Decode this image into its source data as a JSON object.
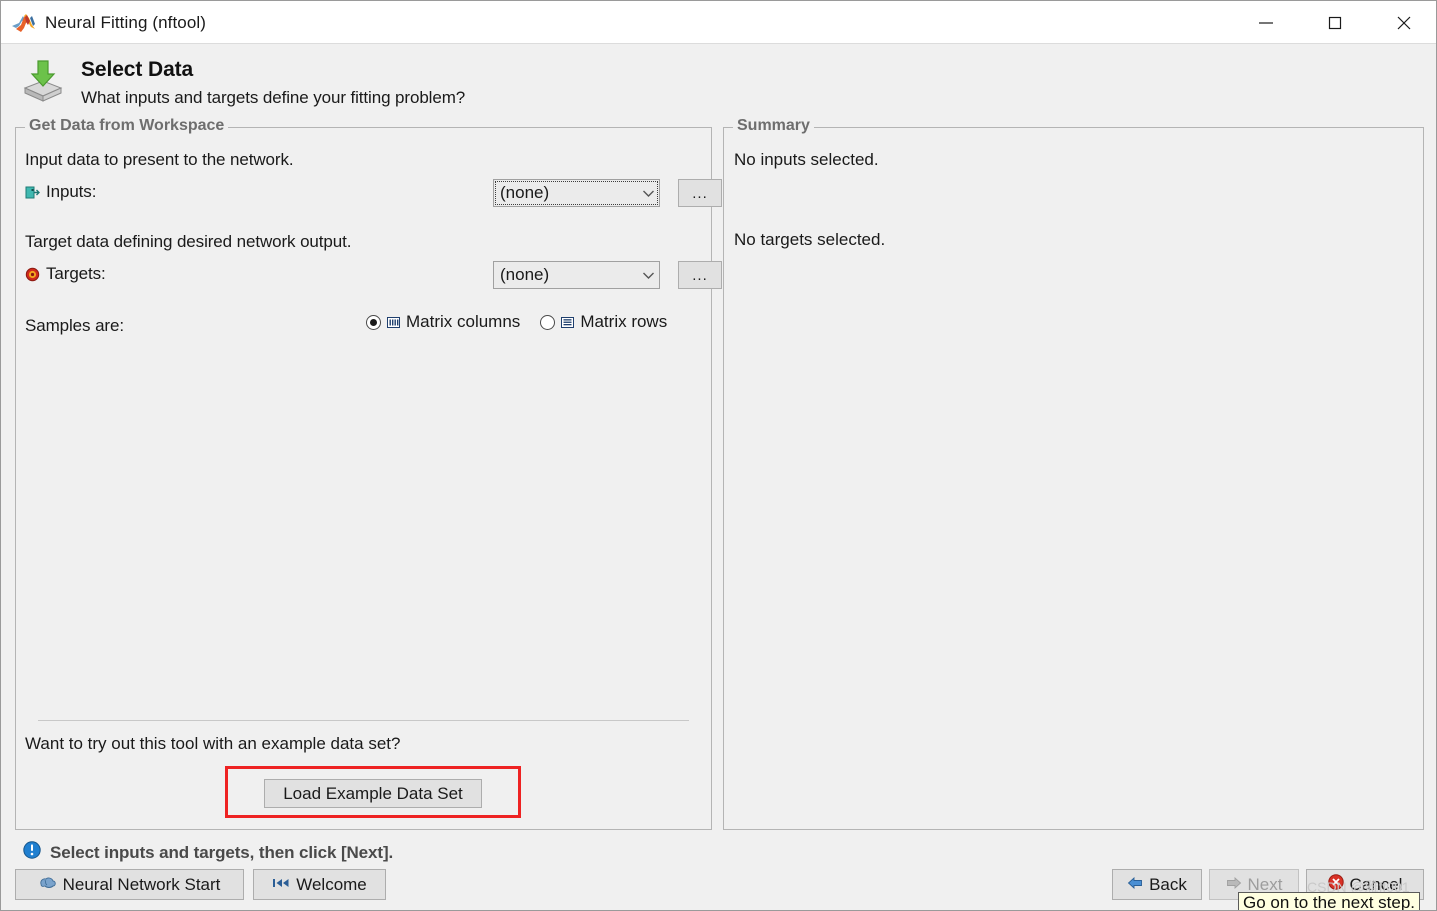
{
  "window": {
    "title": "Neural Fitting (nftool)",
    "logo_icon": "matlab-membrane-icon",
    "minimize_icon": "minimize-icon",
    "maximize_icon": "maximize-icon",
    "close_icon": "close-icon"
  },
  "header": {
    "icon": "import-data-icon",
    "title": "Select Data",
    "subtitle": "What inputs and targets define your fitting problem?"
  },
  "left_panel": {
    "title": "Get Data from Workspace",
    "input_description": "Input data to present to the network.",
    "inputs_label": "Inputs:",
    "inputs_icon": "input-port-icon",
    "inputs_value": "(none)",
    "inputs_browse_label": "...",
    "target_description": "Target data defining desired network output.",
    "targets_label": "Targets:",
    "targets_icon": "target-bullseye-icon",
    "targets_value": "(none)",
    "targets_browse_label": "...",
    "samples_label": "Samples are:",
    "samples_options": [
      {
        "label": "Matrix columns",
        "icon": "matrix-columns-icon",
        "selected": true
      },
      {
        "label": "Matrix rows",
        "icon": "matrix-rows-icon",
        "selected": false
      }
    ],
    "example_question": "Want to try out this tool with an example data set?",
    "load_example_label": "Load Example Data Set",
    "highlight_color": "#ee2222"
  },
  "right_panel": {
    "title": "Summary",
    "inputs_summary": "No inputs selected.",
    "targets_summary": "No targets selected."
  },
  "status": {
    "icon": "info-icon",
    "text": "Select inputs and targets, then click [Next]."
  },
  "footer": {
    "neural_network_start_label": "Neural Network Start",
    "neural_network_start_icon": "brain-icon",
    "welcome_label": "Welcome",
    "welcome_icon": "skip-back-icon",
    "back_label": "Back",
    "back_icon": "arrow-left-icon",
    "next_label": "Next",
    "next_icon": "arrow-right-icon",
    "next_disabled": true,
    "cancel_label": "Cancel",
    "cancel_icon": "cancel-icon"
  },
  "overlay": {
    "tooltip_text": "Go on to the next step.",
    "watermark_text": "CSDN @雅ff001"
  }
}
